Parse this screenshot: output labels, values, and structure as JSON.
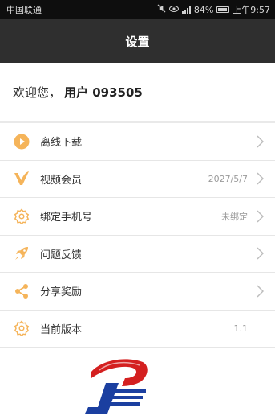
{
  "status_bar": {
    "carrier": "中国联通",
    "battery": "84%",
    "time": "上午9:57",
    "icons": [
      "mute-icon",
      "eye-icon",
      "signal-icon",
      "battery-icon"
    ]
  },
  "header": {
    "title": "设置"
  },
  "welcome": {
    "greeting": "欢迎您，",
    "user": "用户 093505"
  },
  "menu": {
    "items": [
      {
        "label": "离线下载",
        "value": "",
        "icon": "play-circle-icon",
        "chevron": true
      },
      {
        "label": "视频会员",
        "value": "2027/5/7",
        "icon": "vip-v-icon",
        "chevron": true
      },
      {
        "label": "绑定手机号",
        "value": "未绑定",
        "icon": "gear-icon",
        "chevron": true
      },
      {
        "label": "问题反馈",
        "value": "",
        "icon": "rocket-icon",
        "chevron": true
      },
      {
        "label": "分享奖励",
        "value": "",
        "icon": "share-icon",
        "chevron": true
      },
      {
        "label": "当前版本",
        "value": "1.1",
        "icon": "gear-icon",
        "chevron": false
      }
    ]
  },
  "colors": {
    "accent": "#f5b45a",
    "header_bg": "#2f2f2f",
    "logo_red": "#d42020",
    "logo_blue": "#1b3fa0"
  }
}
